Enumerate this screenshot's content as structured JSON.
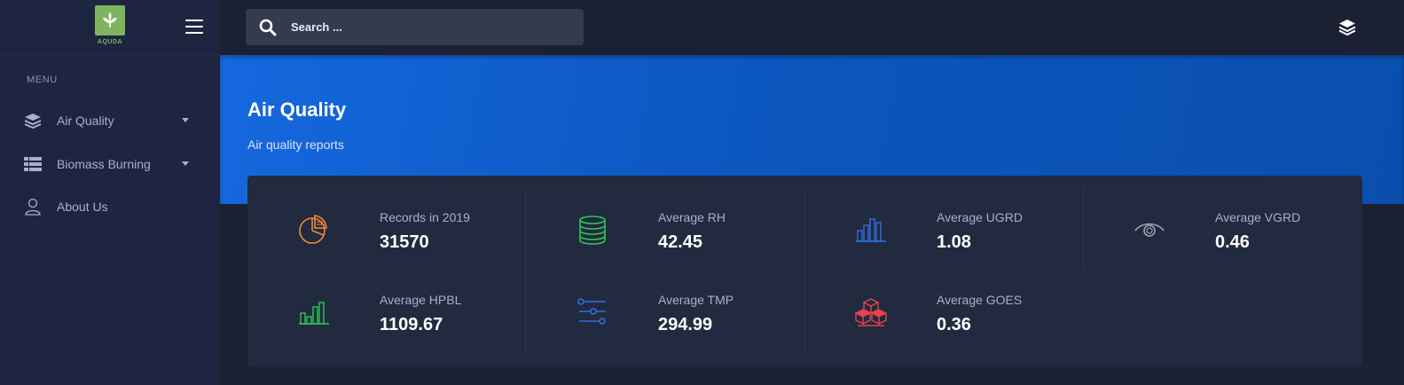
{
  "brand": {
    "logo_text": "AQUDA"
  },
  "search": {
    "placeholder": "Search ..."
  },
  "sidebar": {
    "menu_title": "MENU",
    "items": [
      {
        "label": "Air Quality",
        "icon": "layers-icon",
        "has_caret": true
      },
      {
        "label": "Biomass Burning",
        "icon": "table-list-icon",
        "has_caret": true
      },
      {
        "label": "About Us",
        "icon": "user-icon",
        "has_caret": false
      }
    ]
  },
  "hero": {
    "title": "Air Quality",
    "subtitle": "Air quality reports"
  },
  "stats": [
    {
      "label": "Records in 2019",
      "value": "31570",
      "icon": "pie-chart-icon",
      "color": "#f28b36"
    },
    {
      "label": "Average RH",
      "value": "42.45",
      "icon": "coins-icon",
      "color": "#2dc653"
    },
    {
      "label": "Average UGRD",
      "value": "1.08",
      "icon": "bar-chart-icon",
      "color": "#2f6fe0"
    },
    {
      "label": "Average VGRD",
      "value": "0.46",
      "icon": "eye-icon",
      "color": "#9aa1b5"
    },
    {
      "label": "Average HPBL",
      "value": "1109.67",
      "icon": "bar-chart-icon",
      "color": "#2dc653"
    },
    {
      "label": "Average TMP",
      "value": "294.99",
      "icon": "sliders-icon",
      "color": "#2f6fe0"
    },
    {
      "label": "Average GOES",
      "value": "0.36",
      "icon": "boxes-icon",
      "color": "#e8424f"
    }
  ],
  "colors": {
    "accent": "#1568de",
    "sidebar_bg": "#1e2540",
    "card_bg": "#222a3f"
  }
}
